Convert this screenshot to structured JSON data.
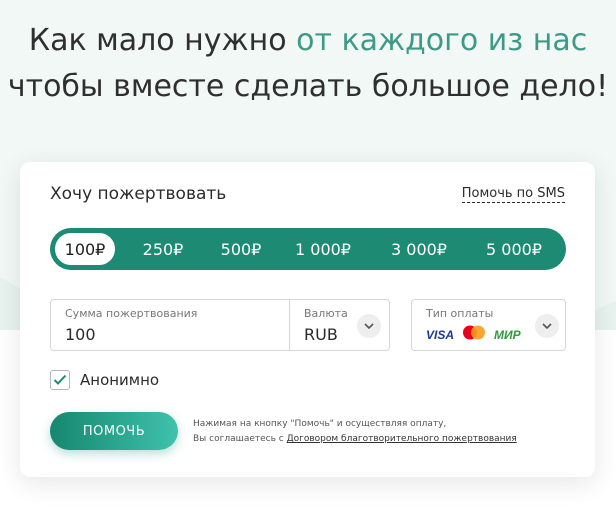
{
  "headline": {
    "line1_plain": "Как мало нужно ",
    "line1_accent": "от каждого из нас",
    "line2": "чтобы вместе сделать большое дело!"
  },
  "form": {
    "title": "Хочу пожертвовать",
    "sms_link": "Помочь по SMS",
    "amounts": [
      {
        "label": "100₽",
        "selected": true
      },
      {
        "label": "250₽",
        "selected": false
      },
      {
        "label": "500₽",
        "selected": false
      },
      {
        "label": "1 000₽",
        "selected": false
      },
      {
        "label": "3 000₽",
        "selected": false
      },
      {
        "label": "5 000₽",
        "selected": false
      }
    ],
    "sum_label": "Сумма пожертвования",
    "sum_value": "100",
    "currency_label": "Валюта",
    "currency_value": "RUB",
    "payment_label": "Тип оплаты",
    "payment_logos": {
      "visa": "VISA",
      "mastercard": "mastercard-icon",
      "mir": "МИР"
    },
    "anonymous_label": "Анонимно",
    "anonymous_checked": true,
    "submit_label": "ПОМОЧЬ",
    "notice_line1": "Нажимая на кнопку \"Помочь\" и осуществляя оплату,",
    "notice_line2_prefix": "Вы соглашаетесь с ",
    "notice_link": "Договором благотворительного пожертвования"
  },
  "colors": {
    "accent": "#3d9a86",
    "pill_bg": "#1d8a74",
    "button_gradient_start": "#16876f",
    "button_gradient_end": "#3fc2ac"
  }
}
